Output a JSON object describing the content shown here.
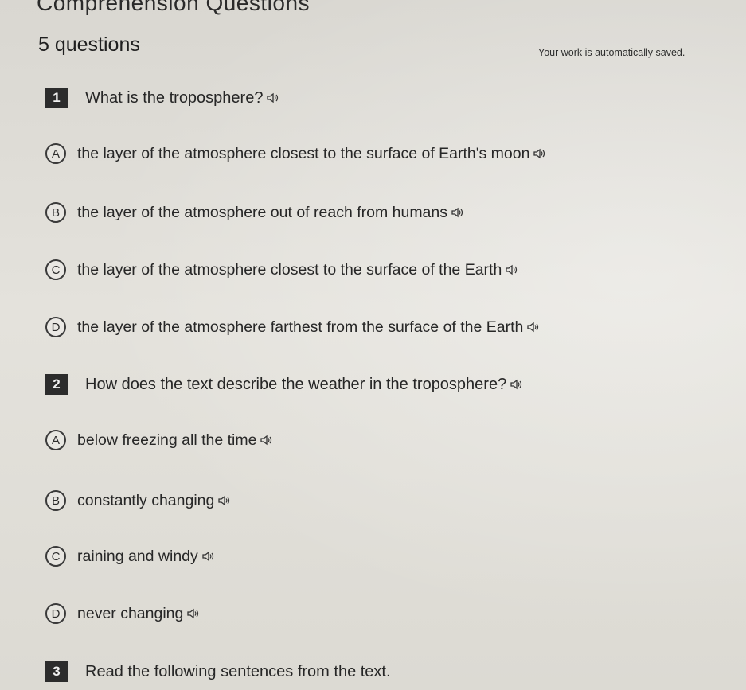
{
  "header": {
    "title": "Comprehension Questions",
    "question_count": "5 questions",
    "autosave_notice": "Your work is automatically saved."
  },
  "questions": [
    {
      "number": "1",
      "text": "What is the troposphere?",
      "options": [
        {
          "letter": "A",
          "text": "the layer of the atmosphere closest to the surface of Earth's moon"
        },
        {
          "letter": "B",
          "text": "the layer of the atmosphere out of reach from humans"
        },
        {
          "letter": "C",
          "text": "the layer of the atmosphere closest to the surface of the Earth"
        },
        {
          "letter": "D",
          "text": "the layer of the atmosphere farthest from the surface of the Earth"
        }
      ]
    },
    {
      "number": "2",
      "text": "How does the text describe the weather in the troposphere?",
      "options": [
        {
          "letter": "A",
          "text": "below freezing all the time"
        },
        {
          "letter": "B",
          "text": "constantly changing"
        },
        {
          "letter": "C",
          "text": "raining and windy"
        },
        {
          "letter": "D",
          "text": "never changing"
        }
      ]
    },
    {
      "number": "3",
      "text": "Read the following sentences from the text."
    }
  ],
  "icons": {
    "audio": "speaker-icon"
  },
  "colors": {
    "background": "#dedcd6",
    "number_badge": "#2c2c2c",
    "text": "#262626"
  }
}
